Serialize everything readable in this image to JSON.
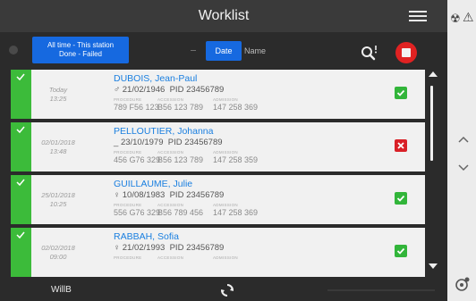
{
  "header": {
    "title": "Worklist",
    "menu_icon": "hamburger-menu-icon"
  },
  "filter": {
    "chip_line1": "All time - This station",
    "chip_line2": "Done - Failed",
    "sort_date": "Date",
    "sort_name": "Name",
    "search_icon": "search-icon",
    "record_icon": "record-icon"
  },
  "columns": {
    "procedure": "PROCEDURE",
    "accession": "ACCESSION",
    "admission": "ADMISSION"
  },
  "rows": [
    {
      "date1": "Today",
      "date2": "13:25",
      "name": "DUBOIS, Jean-Paul",
      "sex_icon": "male-icon",
      "sex_glyph": "♂",
      "dob": "21/02/1946",
      "pid": "PID 23456789",
      "procedure": "789 F56 123",
      "accession": "B56 123 789",
      "admission": "147 258 369",
      "status": "done"
    },
    {
      "date1": "02/01/2018",
      "date2": "13:48",
      "name": "PELLOUTIER, Johanna",
      "sex_icon": "unknown-sex-icon",
      "sex_glyph": "_",
      "dob": "23/10/1979",
      "pid": "PID 23456789",
      "procedure": "456 G76 329",
      "accession": "B56 123 789",
      "admission": "147 258 359",
      "status": "failed"
    },
    {
      "date1": "25/01/2018",
      "date2": "10:25",
      "name": "GUILLAUME, Julie",
      "sex_icon": "female-icon",
      "sex_glyph": "♀",
      "dob": "10/08/1983",
      "pid": "PID 23456789",
      "procedure": "556 G76 329",
      "accession": "B56 789 456",
      "admission": "147 258 369",
      "status": "done"
    },
    {
      "date1": "02/02/2018",
      "date2": "09:00",
      "name": "RABBAH, Sofia",
      "sex_icon": "female-icon",
      "sex_glyph": "♀",
      "dob": "21/02/1993",
      "pid": "PID 23456789",
      "procedure": "",
      "accession": "",
      "admission": "",
      "status": "done"
    }
  ],
  "footer": {
    "user": "WillB",
    "refresh_icon": "refresh-icon"
  },
  "side": {
    "icon_a": "radiation-icon",
    "glyph_a": "☢",
    "icon_b": "warning-icon",
    "glyph_b": "⚠"
  },
  "colors": {
    "accent": "#1669e0",
    "done": "#3cbb3a",
    "failed": "#d92027",
    "record": "#e02222",
    "name": "#1a7fe0"
  }
}
